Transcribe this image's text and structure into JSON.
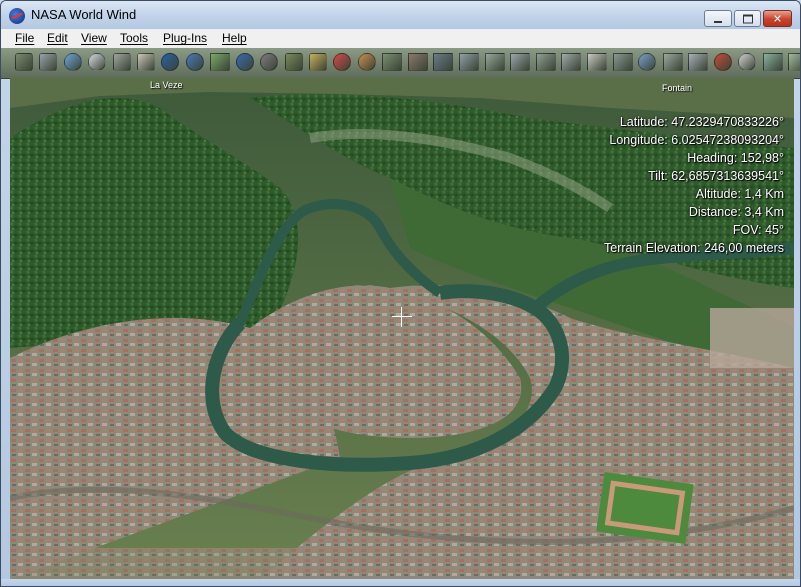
{
  "window": {
    "title": "NASA World Wind",
    "minimize": "",
    "maximize": "",
    "close": "✕"
  },
  "menu": [
    {
      "label": "File"
    },
    {
      "label": "Edit"
    },
    {
      "label": "View"
    },
    {
      "label": "Tools"
    },
    {
      "label": "Plug-Ins"
    },
    {
      "label": "Help"
    }
  ],
  "toolbar": {
    "icons": [
      "satellite-layer-icon",
      "grid-lines-icon",
      "globe-icon",
      "compass-icon",
      "screenshot-icon",
      "find-icon",
      "atmosphere-icon",
      "blue-marble-icon",
      "landsat-icon",
      "earth-icon",
      "moon-icon",
      "terrain-icon",
      "map-icon",
      "rapid-fire-modis-icon",
      "gibs-icon",
      "usgs-topo-icon",
      "urban-area-icon",
      "ortho-icon",
      "tile-layer-icon",
      "tile-layer-2-icon",
      "tile-layer-3-icon",
      "tile-layer-4-icon",
      "tile-layer-5-icon",
      "scale-bar-icon",
      "tile-layer-6-icon",
      "search-globe-icon",
      "measure-icon",
      "layer-manager-icon",
      "flag-icon",
      "place-names-icon",
      "boundaries-icon",
      "waypoints-icon"
    ],
    "colors": [
      "#7b8a6e",
      "#9aa3a8",
      "#6ea6d8",
      "#d8dce0",
      "#a0a6a0",
      "#c8c8b8",
      "#2b5fa8",
      "#4a78b8",
      "#7aa86a",
      "#3a6ab0",
      "#7d7d7d",
      "#7a8a5a",
      "#c8b060",
      "#d84848",
      "#c89050",
      "#7a9070",
      "#8a7a6a",
      "#6a7a8a",
      "#8fa0a6",
      "#94a89a",
      "#9aa6aa",
      "#90a090",
      "#a0aaa8",
      "#c8c8c0",
      "#889890",
      "#7aa0c8",
      "#9aa89c",
      "#a8b0b8",
      "#c84a3a",
      "#d0d4d0",
      "#8ab0a0",
      "#a0b89c"
    ]
  },
  "viewport": {
    "place_names": {
      "left": "La Veze",
      "right": "Fontain"
    },
    "readout": {
      "latitude": "Latitude: 47.2329470833226°",
      "longitude": "Longitude: 6.02547238093204°",
      "heading": "Heading: 152,98°",
      "tilt": "Tilt: 62,6857313639541°",
      "altitude": "Altitude: 1,4 Km",
      "distance": "Distance: 3,4 Km",
      "fov": "FOV: 45°",
      "terrain": "Terrain Elevation: 246,00 meters"
    }
  }
}
